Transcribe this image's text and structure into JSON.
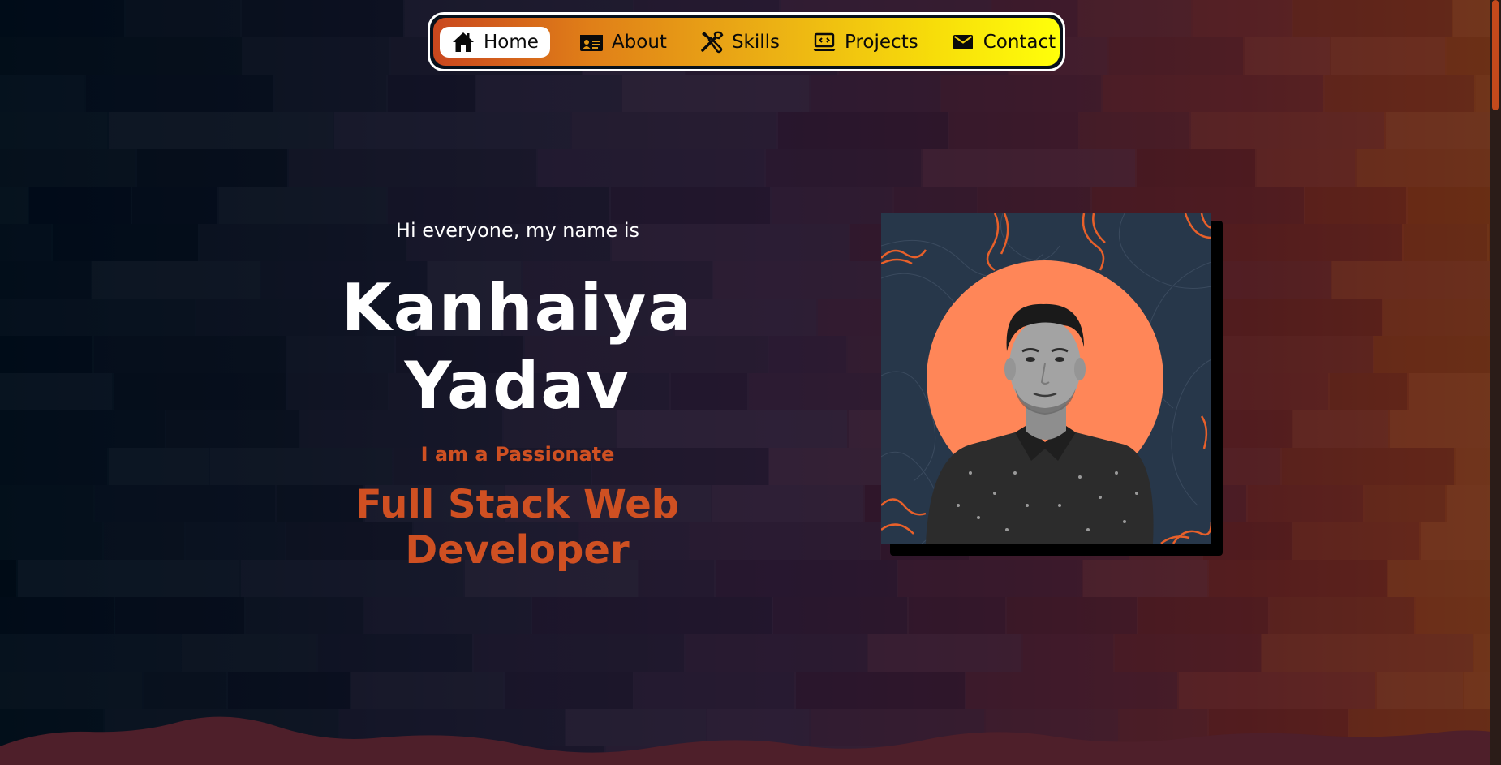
{
  "nav": {
    "items": [
      {
        "label": "Home",
        "icon": "home-icon",
        "active": true
      },
      {
        "label": "About",
        "icon": "id-card-icon",
        "active": false
      },
      {
        "label": "Skills",
        "icon": "tools-icon",
        "active": false
      },
      {
        "label": "Projects",
        "icon": "laptop-code-icon",
        "active": false
      },
      {
        "label": "Contact",
        "icon": "envelope-icon",
        "active": false
      }
    ]
  },
  "hero": {
    "greeting": "Hi everyone, my name is",
    "first_name": "Kanhaiya",
    "last_name": "Yadav",
    "tagline": "I am a Passionate",
    "role": "Full Stack Web Developer"
  },
  "colors": {
    "accent": "#cf5022",
    "nav_gradient_start": "#c9471e",
    "nav_gradient_end": "#ffff0a",
    "portrait_circle": "#ff8658"
  }
}
